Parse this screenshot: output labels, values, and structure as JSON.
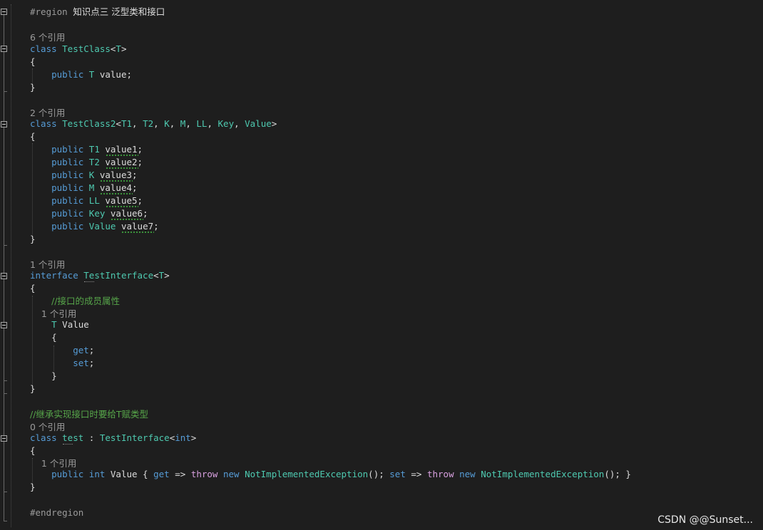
{
  "editor": {
    "lines": [
      {
        "tokens": [
          {
            "t": "#region ",
            "c": "pre"
          },
          {
            "t": "知识点三 泛型类和接口",
            "c": "prec"
          }
        ]
      },
      {
        "tokens": []
      },
      {
        "hint": "6 个引用"
      },
      {
        "tokens": [
          {
            "t": "class ",
            "c": "kw"
          },
          {
            "t": "TestClass",
            "c": "typ"
          },
          {
            "t": "<",
            "c": "txt"
          },
          {
            "t": "T",
            "c": "typ"
          },
          {
            "t": ">",
            "c": "txt"
          }
        ]
      },
      {
        "tokens": [
          {
            "t": "{",
            "c": "txt"
          }
        ]
      },
      {
        "tokens": [
          {
            "t": "    public ",
            "c": "kw"
          },
          {
            "t": "T",
            "c": "typ"
          },
          {
            "t": " value;",
            "c": "txt"
          }
        ]
      },
      {
        "tokens": [
          {
            "t": "}",
            "c": "txt"
          }
        ]
      },
      {
        "tokens": []
      },
      {
        "hint": "2 个引用"
      },
      {
        "tokens": [
          {
            "t": "class ",
            "c": "kw"
          },
          {
            "t": "TestClass2",
            "c": "typ"
          },
          {
            "t": "<",
            "c": "txt"
          },
          {
            "t": "T1",
            "c": "typ"
          },
          {
            "t": ", ",
            "c": "txt"
          },
          {
            "t": "T2",
            "c": "typ"
          },
          {
            "t": ", ",
            "c": "txt"
          },
          {
            "t": "K",
            "c": "typ"
          },
          {
            "t": ", ",
            "c": "txt"
          },
          {
            "t": "M",
            "c": "typ"
          },
          {
            "t": ", ",
            "c": "txt"
          },
          {
            "t": "LL",
            "c": "typ"
          },
          {
            "t": ", ",
            "c": "txt"
          },
          {
            "t": "Key",
            "c": "typ"
          },
          {
            "t": ", ",
            "c": "txt"
          },
          {
            "t": "Value",
            "c": "typ"
          },
          {
            "t": ">",
            "c": "txt"
          }
        ]
      },
      {
        "tokens": [
          {
            "t": "{",
            "c": "txt"
          }
        ]
      },
      {
        "tokens": [
          {
            "t": "    public ",
            "c": "kw"
          },
          {
            "t": "T1",
            "c": "typ"
          },
          {
            "t": " value1;",
            "c": "txt"
          }
        ]
      },
      {
        "tokens": [
          {
            "t": "    public ",
            "c": "kw"
          },
          {
            "t": "T2",
            "c": "typ"
          },
          {
            "t": " value2;",
            "c": "txt"
          }
        ]
      },
      {
        "tokens": [
          {
            "t": "    public ",
            "c": "kw"
          },
          {
            "t": "K",
            "c": "typ"
          },
          {
            "t": " value3;",
            "c": "txt"
          }
        ]
      },
      {
        "tokens": [
          {
            "t": "    public ",
            "c": "kw"
          },
          {
            "t": "M",
            "c": "typ"
          },
          {
            "t": " value4;",
            "c": "txt"
          }
        ]
      },
      {
        "tokens": [
          {
            "t": "    public ",
            "c": "kw"
          },
          {
            "t": "LL",
            "c": "typ"
          },
          {
            "t": " value5;",
            "c": "txt"
          }
        ]
      },
      {
        "tokens": [
          {
            "t": "    public ",
            "c": "kw"
          },
          {
            "t": "Key",
            "c": "typ"
          },
          {
            "t": " value6;",
            "c": "txt"
          }
        ]
      },
      {
        "tokens": [
          {
            "t": "    public ",
            "c": "kw"
          },
          {
            "t": "Value",
            "c": "typ"
          },
          {
            "t": " value7;",
            "c": "txt"
          }
        ]
      },
      {
        "tokens": [
          {
            "t": "}",
            "c": "txt"
          }
        ]
      },
      {
        "tokens": []
      },
      {
        "hint": "1 个引用"
      },
      {
        "tokens": [
          {
            "t": "interface ",
            "c": "kw"
          },
          {
            "t": "TestInterface",
            "c": "typ"
          },
          {
            "t": "<",
            "c": "txt"
          },
          {
            "t": "T",
            "c": "typ"
          },
          {
            "t": ">",
            "c": "txt"
          }
        ]
      },
      {
        "tokens": [
          {
            "t": "{",
            "c": "txt"
          }
        ]
      },
      {
        "tokens": [
          {
            "t": "    ",
            "c": "txt"
          },
          {
            "t": "//接口的成员属性",
            "c": "com"
          }
        ]
      },
      {
        "hint": "    1 个引用"
      },
      {
        "tokens": [
          {
            "t": "    ",
            "c": "txt"
          },
          {
            "t": "T",
            "c": "typ"
          },
          {
            "t": " Value",
            "c": "txt"
          }
        ]
      },
      {
        "tokens": [
          {
            "t": "    {",
            "c": "txt"
          }
        ]
      },
      {
        "tokens": [
          {
            "t": "        get",
            "c": "kw"
          },
          {
            "t": ";",
            "c": "txt"
          }
        ]
      },
      {
        "tokens": [
          {
            "t": "        set",
            "c": "kw"
          },
          {
            "t": ";",
            "c": "txt"
          }
        ]
      },
      {
        "tokens": [
          {
            "t": "    }",
            "c": "txt"
          }
        ]
      },
      {
        "tokens": [
          {
            "t": "}",
            "c": "txt"
          }
        ]
      },
      {
        "tokens": []
      },
      {
        "tokens": [
          {
            "t": "//继承实现接口时要给T赋类型",
            "c": "com"
          }
        ]
      },
      {
        "hint": "0 个引用"
      },
      {
        "tokens": [
          {
            "t": "class ",
            "c": "kw"
          },
          {
            "t": "test",
            "c": "typ"
          },
          {
            "t": " : ",
            "c": "txt"
          },
          {
            "t": "TestInterface",
            "c": "typ"
          },
          {
            "t": "<",
            "c": "txt"
          },
          {
            "t": "int",
            "c": "kw"
          },
          {
            "t": ">",
            "c": "txt"
          }
        ]
      },
      {
        "tokens": [
          {
            "t": "{",
            "c": "txt"
          }
        ]
      },
      {
        "hint": "    1 个引用"
      },
      {
        "tokens": [
          {
            "t": "    public ",
            "c": "kw"
          },
          {
            "t": "int ",
            "c": "kw"
          },
          {
            "t": "Value { ",
            "c": "txt"
          },
          {
            "t": "get",
            "c": "kw"
          },
          {
            "t": " => ",
            "c": "txt"
          },
          {
            "t": "throw ",
            "c": "ctrl"
          },
          {
            "t": "new ",
            "c": "kw"
          },
          {
            "t": "NotImplementedException",
            "c": "typ"
          },
          {
            "t": "(); ",
            "c": "txt"
          },
          {
            "t": "set",
            "c": "kw"
          },
          {
            "t": " => ",
            "c": "txt"
          },
          {
            "t": "throw ",
            "c": "ctrl"
          },
          {
            "t": "new ",
            "c": "kw"
          },
          {
            "t": "NotImplementedException",
            "c": "typ"
          },
          {
            "t": "(); }",
            "c": "txt"
          }
        ]
      },
      {
        "tokens": [
          {
            "t": "}",
            "c": "txt"
          }
        ]
      },
      {
        "tokens": []
      },
      {
        "tokens": [
          {
            "t": "#endregion",
            "c": "pre"
          }
        ]
      }
    ]
  },
  "watermark": "CSDN @@Sunset..."
}
